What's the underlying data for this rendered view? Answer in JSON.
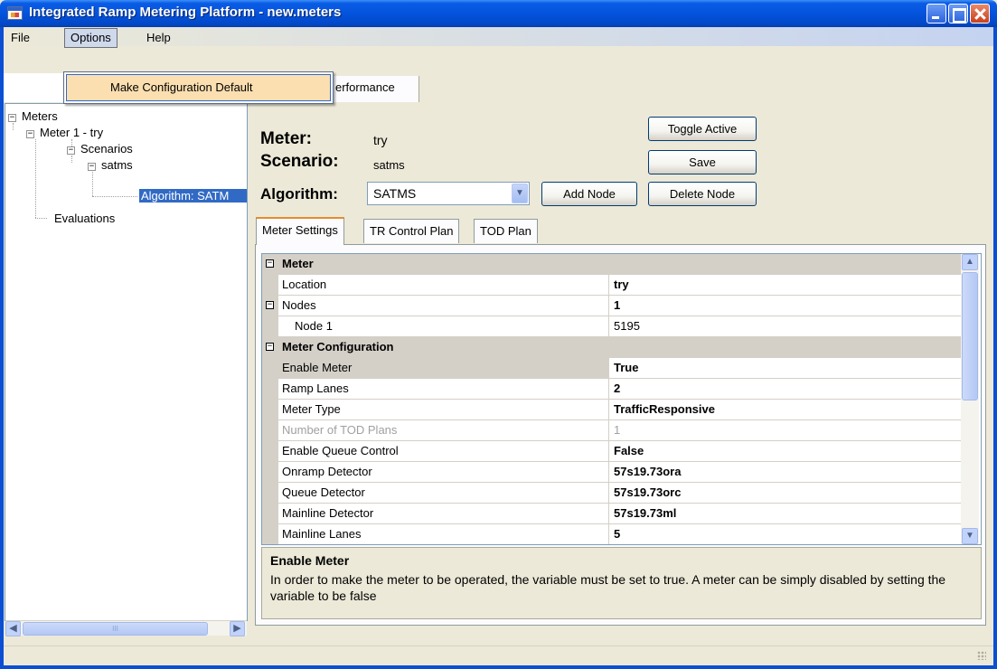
{
  "window": {
    "title": "Integrated Ramp Metering Platform - new.meters"
  },
  "menu": {
    "file": "File",
    "options": "Options",
    "help": "Help",
    "options_items": [
      "Make Configuration Default"
    ]
  },
  "top_tabs": {
    "performance_partial": "erformance"
  },
  "tree": {
    "meters": "Meters",
    "meter1": "Meter 1 - try",
    "scenarios": "Scenarios",
    "satms": "satms",
    "algorithm": "Algorithm: SATM",
    "evaluations": "Evaluations",
    "scroll_thumb_grip": "III"
  },
  "header": {
    "meter_label": "Meter:",
    "meter_value": "try",
    "scenario_label": "Scenario:",
    "scenario_value": "satms",
    "algorithm_label": "Algorithm:",
    "algorithm_selected": "SATMS"
  },
  "buttons": {
    "toggle_active": "Toggle Active",
    "save": "Save",
    "add_node": "Add Node",
    "delete_node": "Delete Node"
  },
  "inner_tabs": [
    "Meter Settings",
    "TR Control Plan",
    "TOD Plan"
  ],
  "grid": {
    "rows": [
      {
        "type": "category",
        "name": "Meter",
        "expand": "−"
      },
      {
        "type": "prop",
        "name": "Location",
        "value": "try",
        "bold": true
      },
      {
        "type": "prop",
        "name": "Nodes",
        "value": "1",
        "bold": true,
        "expand": "−"
      },
      {
        "type": "prop",
        "name": "Node 1",
        "value": "5195",
        "bold": false,
        "indent": true
      },
      {
        "type": "category",
        "name": "Meter Configuration",
        "expand": "−"
      },
      {
        "type": "prop",
        "name": "Enable Meter",
        "value": "True",
        "bold": true,
        "selected": true
      },
      {
        "type": "prop",
        "name": "Ramp Lanes",
        "value": "2",
        "bold": true
      },
      {
        "type": "prop",
        "name": "Meter Type",
        "value": "TrafficResponsive",
        "bold": true
      },
      {
        "type": "prop",
        "name": "Number of TOD Plans",
        "value": "1",
        "bold": false,
        "disabled": true
      },
      {
        "type": "prop",
        "name": "Enable Queue Control",
        "value": "False",
        "bold": true
      },
      {
        "type": "prop",
        "name": "Onramp Detector",
        "value": "57s19.73ora",
        "bold": true
      },
      {
        "type": "prop",
        "name": "Queue Detector",
        "value": "57s19.73orc",
        "bold": true
      },
      {
        "type": "prop",
        "name": "Mainline Detector",
        "value": "57s19.73ml",
        "bold": true
      },
      {
        "type": "prop",
        "name": "Mainline Lanes",
        "value": "5",
        "bold": true
      }
    ]
  },
  "description": {
    "title": "Enable Meter",
    "text": "In order to make the meter to be operated, the variable must be set to true. A meter can be simply disabled by setting the variable to be false"
  }
}
